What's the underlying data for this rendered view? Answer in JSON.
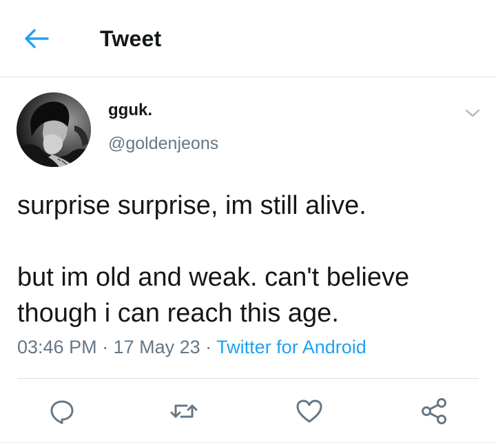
{
  "header": {
    "title": "Tweet",
    "back_icon": "arrow-left-icon",
    "accent": "#1da1f2"
  },
  "author": {
    "display_name": "gguk.",
    "handle": "@goldenjeons",
    "avatar": "profile-photo"
  },
  "tweet": {
    "line1": "surprise surprise, im still alive.",
    "line2": "but im old and weak. can't believe",
    "line3": "though i can reach this age."
  },
  "meta": {
    "time": "03:46 PM",
    "sep1": " · ",
    "date": "17 May 23",
    "sep2": " · ",
    "source": "Twitter for Android"
  },
  "actions": [
    "reply-icon",
    "retweet-icon",
    "like-icon",
    "share-icon"
  ],
  "colors": {
    "text": "#14171a",
    "secondary": "#657786",
    "link": "#1da1f2",
    "icon": "#657786"
  }
}
